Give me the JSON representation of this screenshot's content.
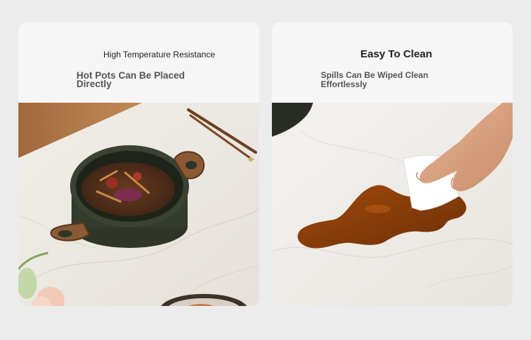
{
  "cards": [
    {
      "title": "High Temperature Resistance",
      "subtitle": "Hot Pots Can Be Placed Directly",
      "image": "cookware pot with soup on marble table"
    },
    {
      "title": "Easy To Clean",
      "subtitle": "Spills Can Be Wiped Clean Effortlessly",
      "image": "hand wiping spilled sauce with tissue on marble table"
    }
  ],
  "colors": {
    "page_background": "#ececec",
    "card_header": "#f6f6f6",
    "marble": "#ece8e2",
    "wood": "#8a5a35",
    "pot": "#2f3628",
    "sauce": "#8a3e08"
  }
}
